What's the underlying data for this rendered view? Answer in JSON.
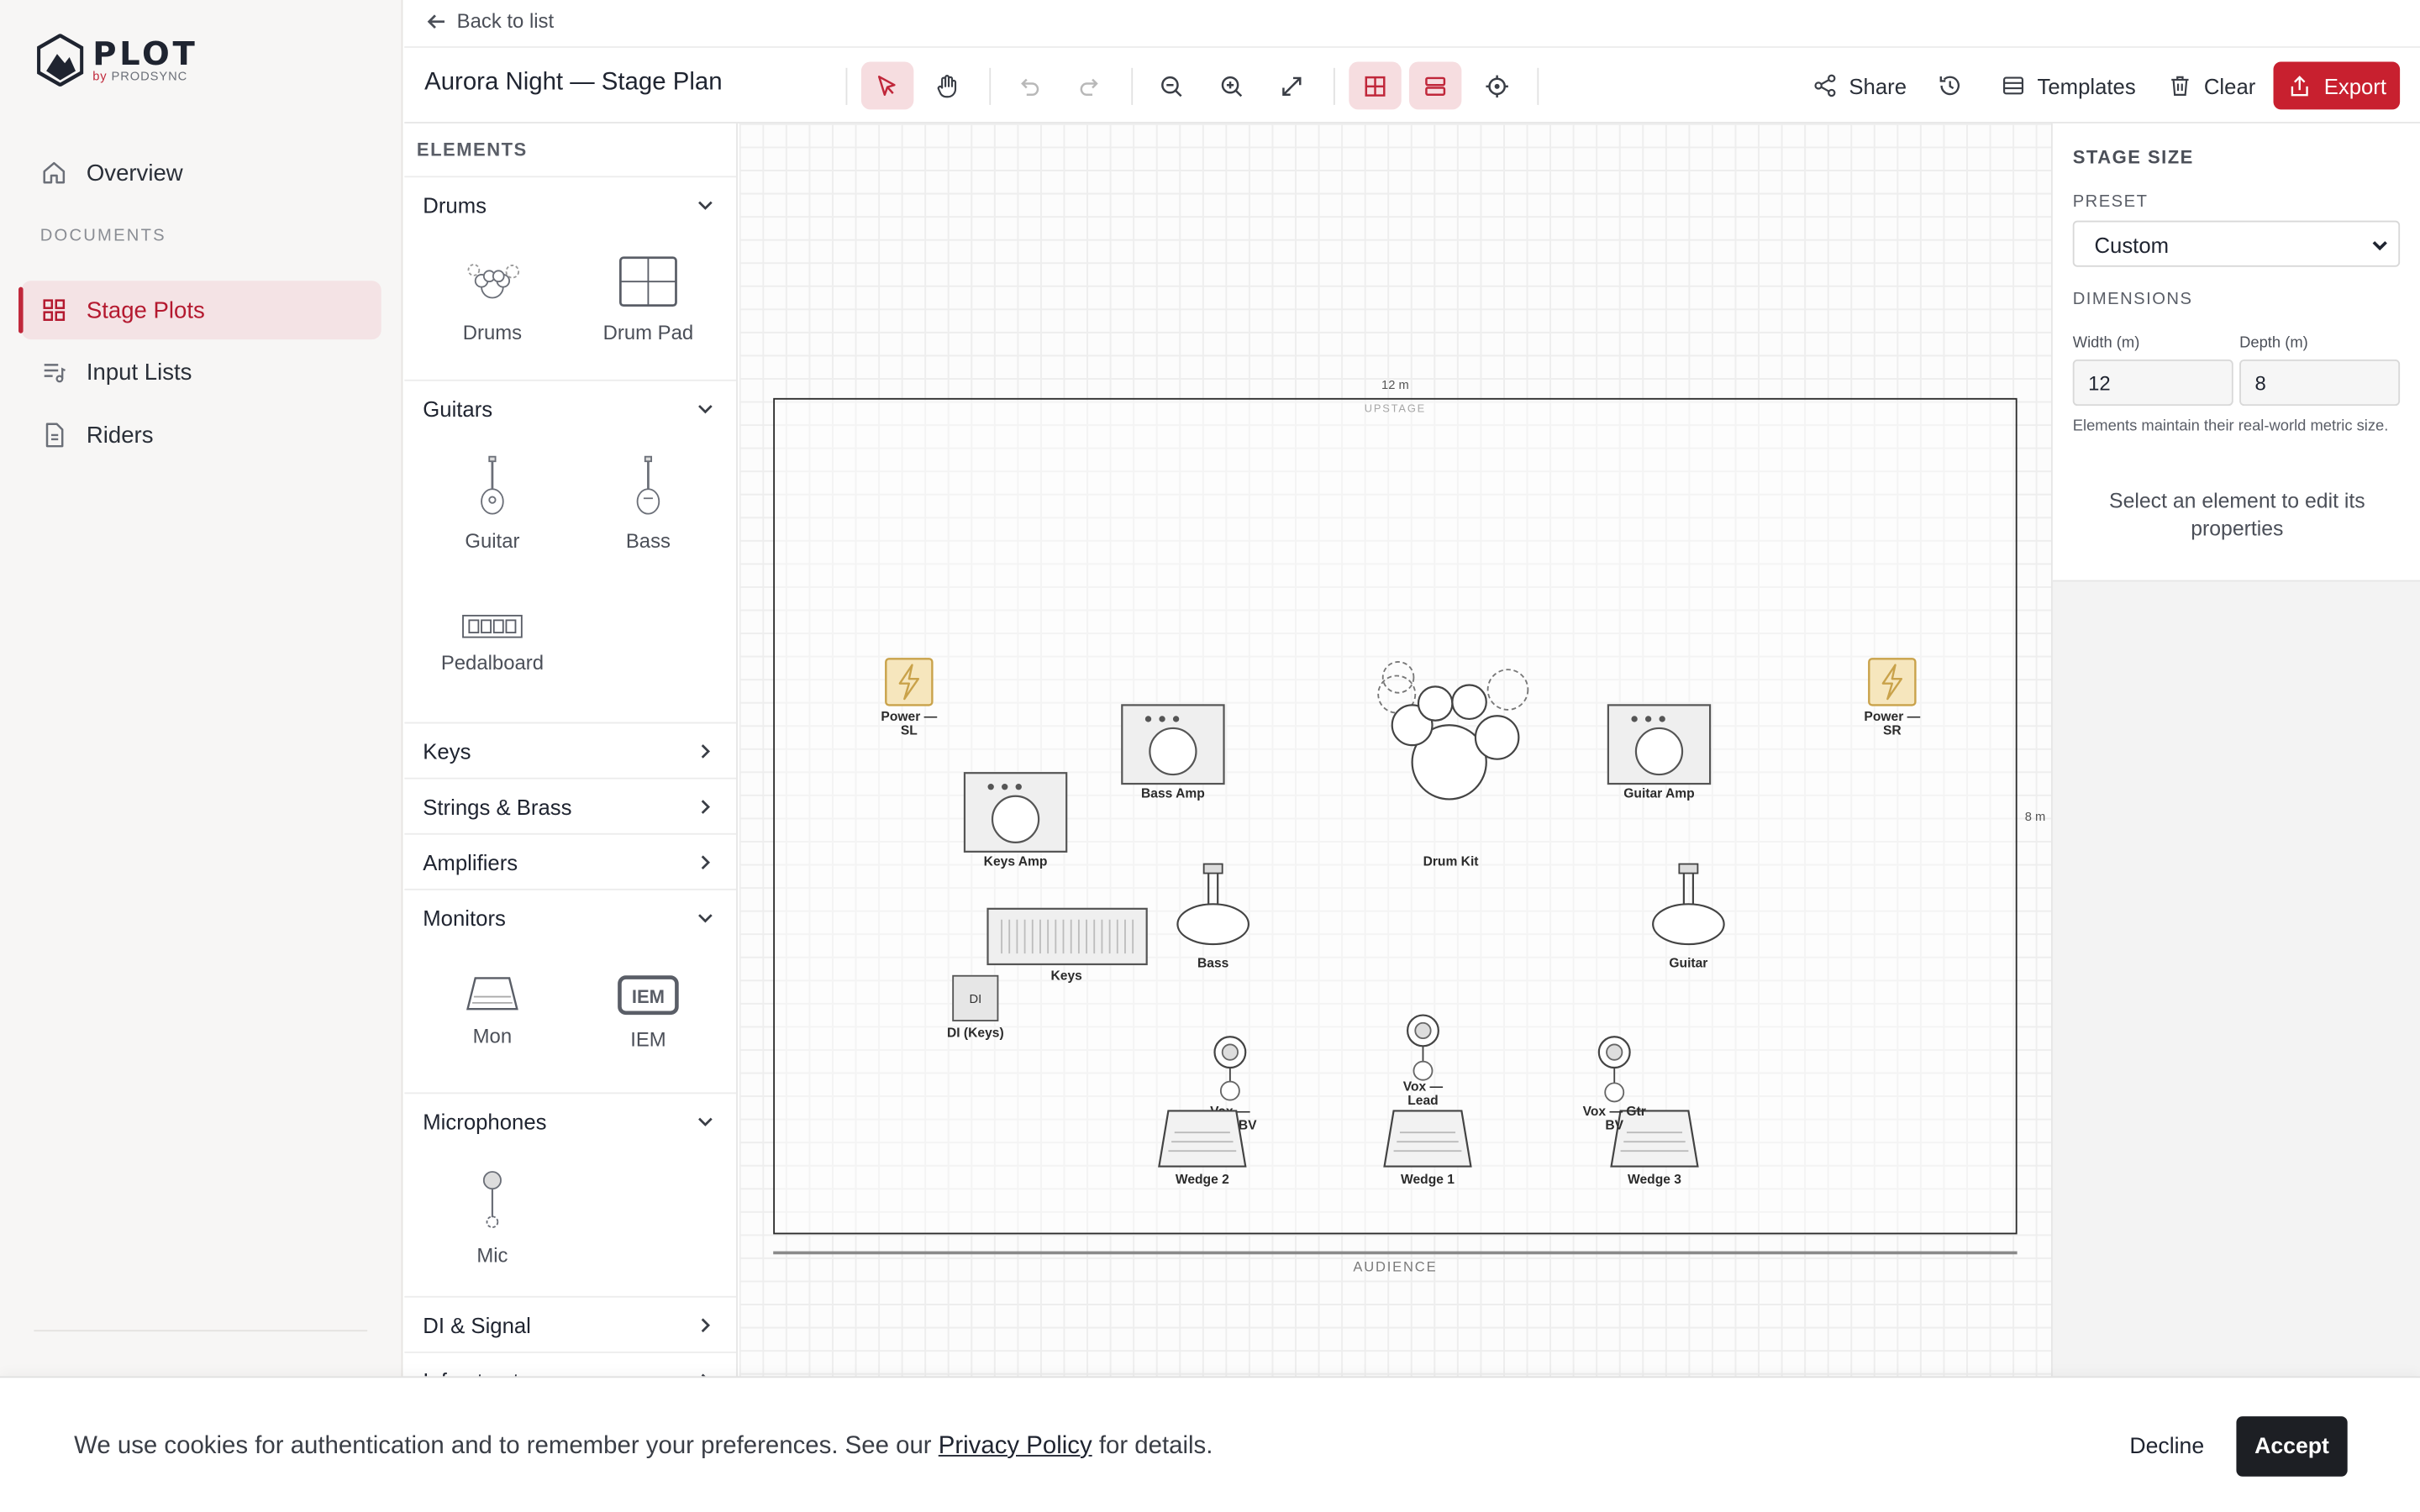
{
  "brand": {
    "name": "PLOT",
    "sub_prefix": "by ",
    "sub_name": "PRODSYNC"
  },
  "nav": {
    "overview": "Overview",
    "section": "DOCUMENTS",
    "items": [
      {
        "label": "Stage Plots",
        "icon": "grid-icon",
        "active": true
      },
      {
        "label": "Input Lists",
        "icon": "list-music-icon"
      },
      {
        "label": "Riders",
        "icon": "document-icon"
      }
    ]
  },
  "header": {
    "back": "Back to list",
    "title": "Aurora Night — Stage Plan",
    "share": "Share",
    "templates": "Templates",
    "clear": "Clear",
    "export": "Export"
  },
  "elements": {
    "heading": "ELEMENTS",
    "categories": {
      "drums": "Drums",
      "guitars": "Guitars",
      "keys": "Keys",
      "strings": "Strings & Brass",
      "amplifiers": "Amplifiers",
      "monitors": "Monitors",
      "microphones": "Microphones",
      "di": "DI & Signal",
      "infrastructure": "Infrastructure"
    },
    "tiles": {
      "drums": "Drums",
      "drum_pad": "Drum Pad",
      "guitar": "Guitar",
      "bass": "Bass",
      "pedalboard": "Pedalboard",
      "mon": "Mon",
      "iem": "IEM",
      "mic": "Mic"
    }
  },
  "canvas": {
    "width_label": "12 m",
    "depth_label": "8 m",
    "upstage": "UPSTAGE",
    "audience": "AUDIENCE",
    "items": {
      "power_sl": "Power — SL",
      "power_sr": "Power — SR",
      "bass_amp": "Bass Amp",
      "keys_amp": "Keys Amp",
      "drum_kit": "Drum Kit",
      "guitar_amp": "Guitar Amp",
      "keys": "Keys",
      "bass": "Bass",
      "guitar": "Guitar",
      "di_keys": "DI (Keys)",
      "di_tag": "DI",
      "vox_bass": "Vox — Bass BV",
      "vox_lead": "Vox — Lead",
      "vox_gtr": "Vox — Gtr BV",
      "wedge1": "Wedge 1",
      "wedge2": "Wedge 2",
      "wedge3": "Wedge 3"
    }
  },
  "props": {
    "heading": "STAGE SIZE",
    "preset_label": "PRESET",
    "preset_value": "Custom",
    "dimensions_label": "DIMENSIONS",
    "width_label": "Width (m)",
    "width_value": "12",
    "depth_label": "Depth (m)",
    "depth_value": "8",
    "note": "Elements maintain their real-world metric size.",
    "hint": "Select an element to edit its properties"
  },
  "cookie": {
    "text_before": "We use cookies for authentication and to remember your preferences. See our ",
    "link": "Privacy Policy",
    "text_after": " for details.",
    "decline": "Decline",
    "accept": "Accept"
  },
  "colors": {
    "accent": "#c8202f",
    "active_bg": "#f4e3e5",
    "power": "#f3e2b5"
  }
}
